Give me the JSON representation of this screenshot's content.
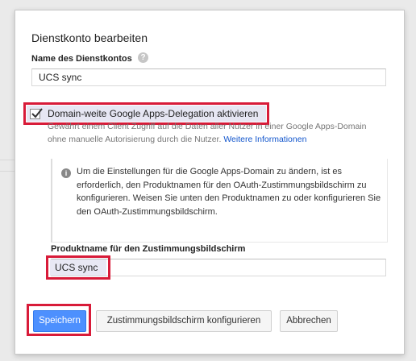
{
  "dialog": {
    "title": "Dienstkonto bearbeiten",
    "name_label": "Name des Dienstkontos",
    "help_icon": "?",
    "name_value": "UCS sync",
    "delegation_checkbox": {
      "label": "Domain-weite Google Apps-Delegation aktivieren",
      "checked": true
    },
    "delegation_desc": "Gewährt einem Client Zugriff auf die Daten aller Nutzer in einer Google Apps-Domain ohne manuelle Autorisierung durch die Nutzer.",
    "more_info_link": "Weitere Informationen",
    "info_icon": "i",
    "info_text": "Um die Einstellungen für die Google Apps-Domain zu ändern, ist es erforderlich, den Produktnamen für den OAuth-Zustimmungsbildschirm zu konfigurieren. Weisen Sie unten den Produktnamen zu oder konfigurieren Sie den OAuth-Zustimmungsbildschirm.",
    "product_label": "Produktname für den Zustimmungsbildschirm",
    "product_value": "UCS sync",
    "buttons": {
      "save": "Speichern",
      "configure_consent": "Zustimmungsbildschirm konfigurieren",
      "cancel": "Abbrechen"
    }
  },
  "colors": {
    "primary_button": "#4d90fe",
    "highlight_border": "#d81b39",
    "link": "#1155cc"
  }
}
